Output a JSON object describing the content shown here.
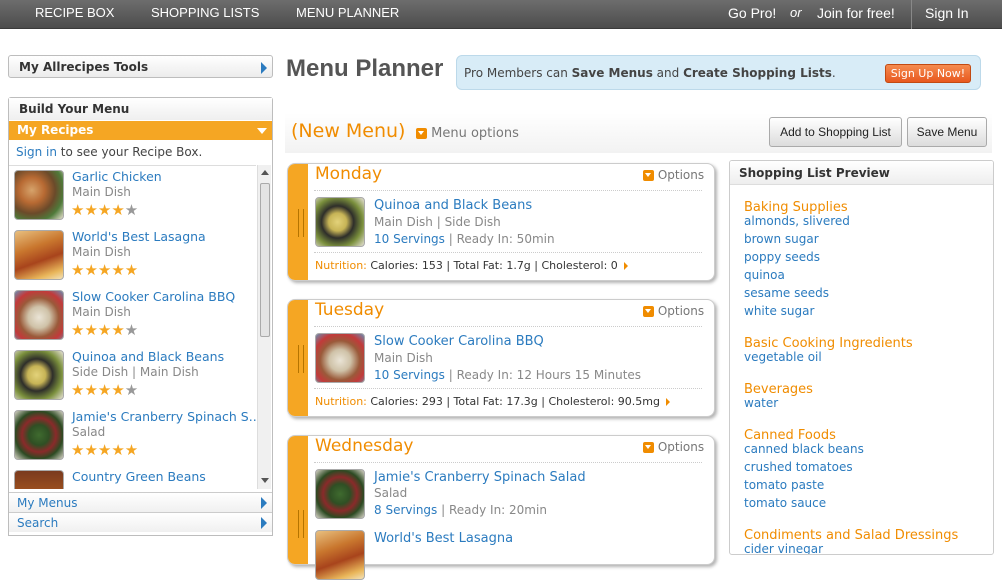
{
  "topnav": {
    "recipe_box": "RECIPE BOX",
    "shopping_lists": "SHOPPING LISTS",
    "menu_planner": "MENU PLANNER",
    "go_pro": "Go Pro!",
    "or": "or",
    "join": "Join for free!",
    "sign_in": "Sign In"
  },
  "sidebar": {
    "tools_label": "My Allrecipes Tools",
    "build_label": "Build Your Menu",
    "my_recipes_label": "My Recipes",
    "sign_in_link": "Sign in",
    "sign_in_note": " to see your Recipe Box.",
    "recipes": [
      {
        "title": "Garlic Chicken",
        "category": "Main Dish",
        "rating": 4.5,
        "stars": "★★★★",
        "star_partial": "★"
      },
      {
        "title": "World's Best Lasagna",
        "category": "Main Dish",
        "rating": 5,
        "stars": "★★★★★",
        "star_partial": ""
      },
      {
        "title": "Slow Cooker Carolina BBQ",
        "category": "Main Dish",
        "rating": 4.5,
        "stars": "★★★★",
        "star_partial": "★"
      },
      {
        "title": "Quinoa and Black Beans",
        "category": "Side Dish | Main Dish",
        "rating": 4.5,
        "stars": "★★★★",
        "star_partial": "★"
      },
      {
        "title": "Jamie's Cranberry Spinach S...",
        "category": "Salad",
        "rating": 5,
        "stars": "★★★★★",
        "star_partial": ""
      },
      {
        "title": "Country Green Beans",
        "category": "",
        "rating": null,
        "stars": "",
        "star_partial": ""
      }
    ],
    "my_menus_label": "My Menus",
    "search_label": "Search"
  },
  "main": {
    "title": "Menu Planner",
    "promo": {
      "prefix": "Pro Members can ",
      "bold1": "Save Menus",
      "middle": " and ",
      "bold2": "Create Shopping Lists",
      "suffix": ".",
      "button": "Sign Up Now!"
    },
    "menu_name": "(New Menu)",
    "menu_options": "Menu options",
    "add_to_shopping_list": "Add to Shopping List",
    "save_menu": "Save Menu",
    "days": [
      {
        "name": "Monday",
        "options": "Options",
        "meals": [
          {
            "title": "Quinoa and Black Beans",
            "category": "Main Dish | Side Dish",
            "servings": "10 Servings",
            "ready": "Ready In: 50min"
          }
        ],
        "nutrition_label": "Nutrition:",
        "nutrition": "Calories: 153 | Total Fat: 1.7g | Cholesterol: 0"
      },
      {
        "name": "Tuesday",
        "options": "Options",
        "meals": [
          {
            "title": "Slow Cooker Carolina BBQ",
            "category": "Main Dish",
            "servings": "10 Servings",
            "ready": "Ready In: 12 Hours 15 Minutes"
          }
        ],
        "nutrition_label": "Nutrition:",
        "nutrition": "Calories: 293 | Total Fat: 17.3g | Cholesterol: 90.5mg"
      },
      {
        "name": "Wednesday",
        "options": "Options",
        "meals": [
          {
            "title": "Jamie's Cranberry Spinach Salad",
            "category": "Salad",
            "servings": "8 Servings",
            "ready": "Ready In: 20min"
          },
          {
            "title": "World's Best Lasagna",
            "category": "",
            "servings": "",
            "ready": ""
          }
        ]
      }
    ]
  },
  "shopping_preview": {
    "title": "Shopping List Preview",
    "categories": [
      {
        "name": "Baking Supplies",
        "items": [
          "almonds, slivered",
          "brown sugar",
          "poppy seeds",
          "quinoa",
          "sesame seeds",
          "white sugar"
        ]
      },
      {
        "name": "Basic Cooking Ingredients",
        "items": [
          "vegetable oil"
        ]
      },
      {
        "name": "Beverages",
        "items": [
          "water"
        ]
      },
      {
        "name": "Canned Foods",
        "items": [
          "canned black beans",
          "crushed tomatoes",
          "tomato paste",
          "tomato sauce"
        ]
      },
      {
        "name": "Condiments and Salad Dressings",
        "items": [
          "cider vinegar"
        ]
      }
    ]
  },
  "colors": {
    "accent_orange": "#f08c00",
    "strip_orange": "#f5a623",
    "link_blue": "#2b7bbf",
    "signup": "#e8581f"
  }
}
